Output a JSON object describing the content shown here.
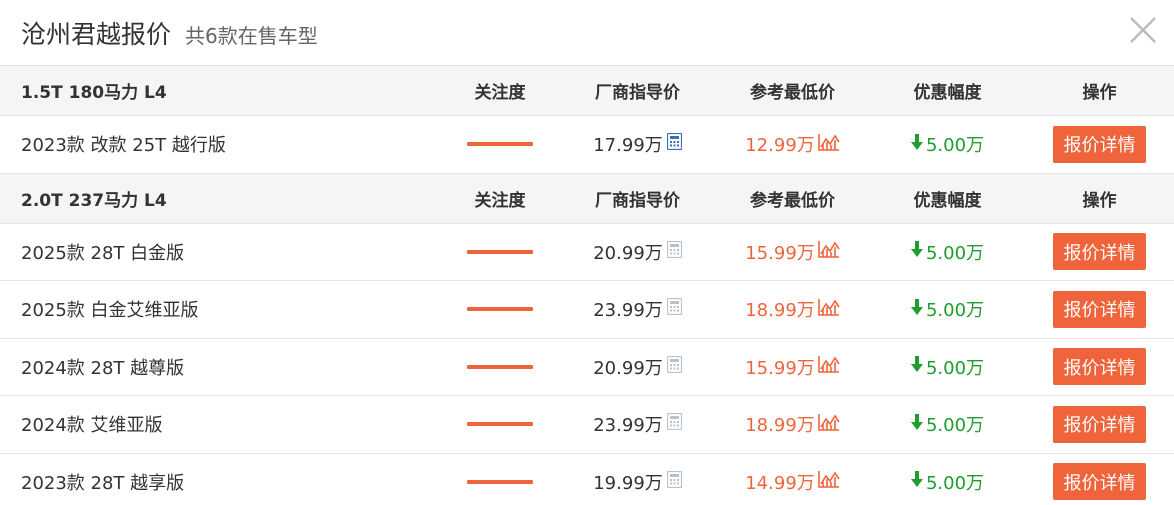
{
  "header": {
    "title": "沧州君越报价",
    "subtitle": "共6款在售车型"
  },
  "columns": {
    "attention": "关注度",
    "guide_price": "厂商指导价",
    "lowest_price": "参考最低价",
    "discount": "优惠幅度",
    "operation": "操作"
  },
  "groups": [
    {
      "name": "1.5T 180马力 L4",
      "items": [
        {
          "name": "2023款 改款 25T 越行版",
          "attention": 1.0,
          "guide_price": "17.99万",
          "lowest_price": "12.99万",
          "discount": "5.00万",
          "button": "报价详情",
          "calc_active": true
        }
      ]
    },
    {
      "name": "2.0T 237马力 L4",
      "items": [
        {
          "name": "2025款 28T 白金版",
          "attention": 1.0,
          "guide_price": "20.99万",
          "lowest_price": "15.99万",
          "discount": "5.00万",
          "button": "报价详情",
          "calc_active": false
        },
        {
          "name": "2025款 白金艾维亚版",
          "attention": 1.0,
          "guide_price": "23.99万",
          "lowest_price": "18.99万",
          "discount": "5.00万",
          "button": "报价详情",
          "calc_active": false
        },
        {
          "name": "2024款 28T 越尊版",
          "attention": 1.0,
          "guide_price": "20.99万",
          "lowest_price": "15.99万",
          "discount": "5.00万",
          "button": "报价详情",
          "calc_active": false
        },
        {
          "name": "2024款 艾维亚版",
          "attention": 1.0,
          "guide_price": "23.99万",
          "lowest_price": "18.99万",
          "discount": "5.00万",
          "button": "报价详情",
          "calc_active": false
        },
        {
          "name": "2023款 28T 越享版",
          "attention": 1.0,
          "guide_price": "19.99万",
          "lowest_price": "14.99万",
          "discount": "5.00万",
          "button": "报价详情",
          "calc_active": false
        }
      ]
    }
  ],
  "icons": {
    "close": "close-icon",
    "calculator": "calculator-icon",
    "trend_chart": "price-trend-chart-icon",
    "discount_arrow": "arrow-down-icon"
  },
  "colors": {
    "accent": "#f0643c",
    "discount": "#1f9d2e",
    "calc_active": "#3a6fb5",
    "calc_inactive": "#b8c2cf"
  }
}
